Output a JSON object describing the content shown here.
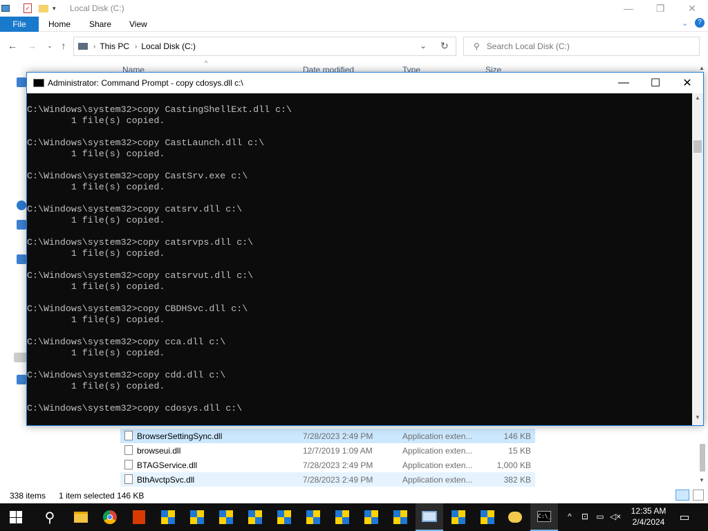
{
  "explorer": {
    "title": "Local Disk (C:)",
    "ribbon_tabs": [
      "File",
      "Home",
      "Share",
      "View"
    ],
    "breadcrumb": [
      "This PC",
      "Local Disk (C:)"
    ],
    "search_placeholder": "Search Local Disk (C:)",
    "columns": [
      "Name",
      "Date modified",
      "Type",
      "Size"
    ],
    "files": [
      {
        "name": "BrowserSettingSync.dll",
        "date": "7/28/2023 2:49 PM",
        "type": "Application exten...",
        "size": "146 KB",
        "state": "selected"
      },
      {
        "name": "browseui.dll",
        "date": "12/7/2019 1:09 AM",
        "type": "Application exten...",
        "size": "15 KB",
        "state": ""
      },
      {
        "name": "BTAGService.dll",
        "date": "7/28/2023 2:49 PM",
        "type": "Application exten...",
        "size": "1,000 KB",
        "state": ""
      },
      {
        "name": "BthAvctpSvc.dll",
        "date": "7/28/2023 2:49 PM",
        "type": "Application exten...",
        "size": "382 KB",
        "state": "hover"
      }
    ],
    "status": {
      "items": "338 items",
      "selection": "1 item selected  146 KB"
    }
  },
  "cmd": {
    "title": "Administrator: Command Prompt - copy  cdosys.dll c:\\",
    "lines": [
      "C:\\Windows\\system32>copy CastingShellExt.dll c:\\",
      "        1 file(s) copied.",
      "",
      "C:\\Windows\\system32>copy CastLaunch.dll c:\\",
      "        1 file(s) copied.",
      "",
      "C:\\Windows\\system32>copy CastSrv.exe c:\\",
      "        1 file(s) copied.",
      "",
      "C:\\Windows\\system32>copy catsrv.dll c:\\",
      "        1 file(s) copied.",
      "",
      "C:\\Windows\\system32>copy catsrvps.dll c:\\",
      "        1 file(s) copied.",
      "",
      "C:\\Windows\\system32>copy catsrvut.dll c:\\",
      "        1 file(s) copied.",
      "",
      "C:\\Windows\\system32>copy CBDHSvc.dll c:\\",
      "        1 file(s) copied.",
      "",
      "C:\\Windows\\system32>copy cca.dll c:\\",
      "        1 file(s) copied.",
      "",
      "C:\\Windows\\system32>copy cdd.dll c:\\",
      "        1 file(s) copied.",
      "",
      "C:\\Windows\\system32>copy cdosys.dll c:\\"
    ]
  },
  "taskbar": {
    "time": "12:35 AM",
    "date": "2/4/2024",
    "icons": [
      "start-icon",
      "search-icon",
      "file-explorer-icon",
      "chrome-icon",
      "office-icon",
      "shield-app-icon",
      "shield-app-icon",
      "shield-app-icon",
      "shield-app-icon",
      "shield-app-icon",
      "shield-app-icon",
      "shield-app-icon",
      "shield-app-icon",
      "shield-app-icon",
      "network-settings-icon",
      "shield-app-icon",
      "shield-app-icon",
      "chat-icon",
      "command-prompt-icon"
    ]
  },
  "colors": {
    "accent": "#1979ca",
    "console_bg": "#0c0c0c",
    "console_text": "#c0c0c0",
    "taskbar": "#101010"
  }
}
